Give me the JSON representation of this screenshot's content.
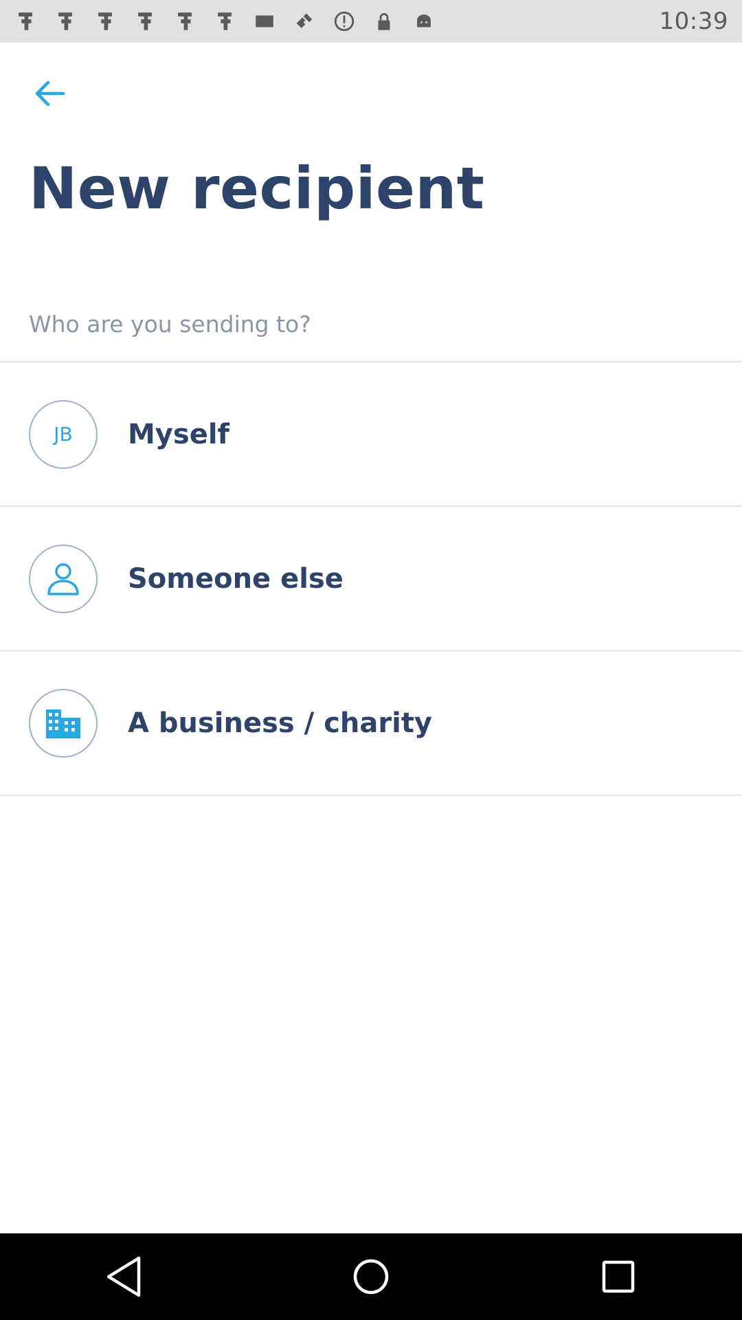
{
  "status_bar": {
    "time": "10:39",
    "icons": [
      "notification-icon",
      "notification-icon",
      "notification-icon",
      "notification-icon",
      "notification-icon",
      "notification-icon",
      "message-icon",
      "fake-gps-icon",
      "alert-icon",
      "lock-icon",
      "android-icon"
    ]
  },
  "header": {
    "back_icon": "arrow-back-icon",
    "title": "New recipient"
  },
  "prompt": "Who are you sending to?",
  "options": [
    {
      "avatar_text": "JB",
      "label": "Myself"
    },
    {
      "icon": "person-icon",
      "label": "Someone else"
    },
    {
      "icon": "building-icon",
      "label": "A business / charity"
    }
  ],
  "colors": {
    "accent": "#29a8e0",
    "title": "#2e4369",
    "subtitle": "#8b94a6",
    "avatar_border": "#9fb1cc"
  },
  "nav_bar": [
    "back-nav-icon",
    "home-nav-icon",
    "recents-nav-icon"
  ]
}
